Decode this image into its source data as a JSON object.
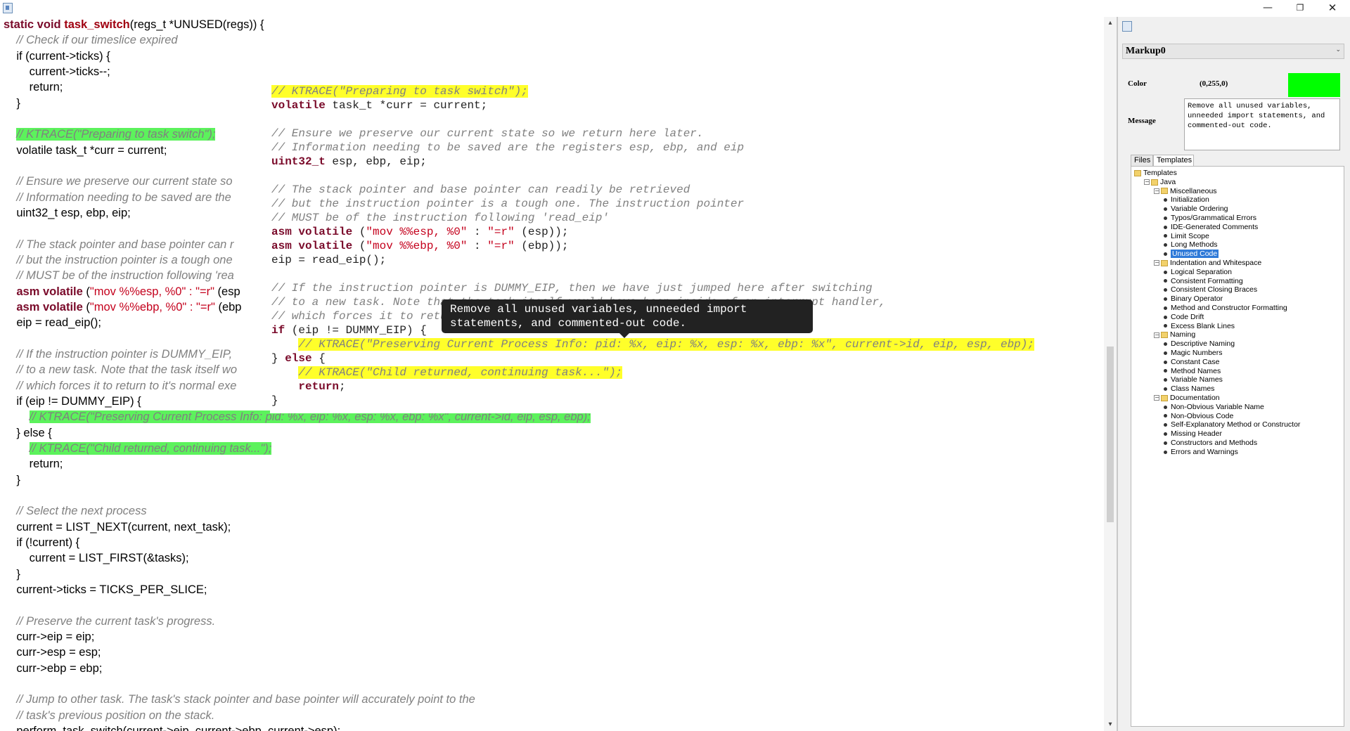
{
  "window": {
    "min_glyph": "—",
    "max_glyph": "❐",
    "close_glyph": "✕"
  },
  "code": {
    "lines": [
      [
        {
          "t": "static void ",
          "c": "kwplain"
        },
        {
          "t": "task_switch",
          "c": "fn"
        },
        {
          "t": "(regs_t *UNUSED(regs)) {",
          "c": "n"
        }
      ],
      [
        {
          "t": "    // Check if our timeslice expired",
          "c": "cm"
        }
      ],
      [
        {
          "t": "    if (current->ticks) {",
          "c": "n"
        }
      ],
      [
        {
          "t": "        current->ticks--;",
          "c": "n"
        }
      ],
      [
        {
          "t": "        return;",
          "c": "n"
        }
      ],
      [
        {
          "t": "    }",
          "c": "n"
        }
      ],
      [],
      [
        {
          "t": "    ",
          "c": "n"
        },
        {
          "t": "// KTRACE(\"Preparing to task switch\");",
          "c": "cm-hl"
        }
      ],
      [
        {
          "t": "    volatile task_t *curr = current;",
          "c": "n"
        }
      ],
      [],
      [
        {
          "t": "    // Ensure we preserve our current state so",
          "c": "cm"
        }
      ],
      [
        {
          "t": "    // Information needing to be saved are the",
          "c": "cm"
        }
      ],
      [
        {
          "t": "    uint32_t esp, ebp, eip;",
          "c": "n"
        }
      ],
      [],
      [
        {
          "t": "    // The stack pointer and base pointer can r",
          "c": "cm"
        }
      ],
      [
        {
          "t": "    // but the instruction pointer is a tough one",
          "c": "cm"
        }
      ],
      [
        {
          "t": "    // MUST be of the instruction following 'rea",
          "c": "cm"
        }
      ],
      [
        {
          "t": "    ",
          "c": "n"
        },
        {
          "t": "asm volatile",
          "c": "kw"
        },
        {
          "t": " (",
          "c": "n"
        },
        {
          "t": "\"mov %%esp, %0\" : \"=r\"",
          "c": "str"
        },
        {
          "t": " (esp",
          "c": "n"
        }
      ],
      [
        {
          "t": "    ",
          "c": "n"
        },
        {
          "t": "asm volatile",
          "c": "kw"
        },
        {
          "t": " (",
          "c": "n"
        },
        {
          "t": "\"mov %%ebp, %0\" : \"=r\"",
          "c": "str"
        },
        {
          "t": " (ebp",
          "c": "n"
        }
      ],
      [
        {
          "t": "    eip = read_eip();",
          "c": "n"
        }
      ],
      [],
      [
        {
          "t": "    // If the instruction pointer is DUMMY_EIP,",
          "c": "cm"
        }
      ],
      [
        {
          "t": "    // to a new task. Note that the task itself wo",
          "c": "cm"
        }
      ],
      [
        {
          "t": "    // which forces it to return to it's normal exe",
          "c": "cm"
        }
      ],
      [
        {
          "t": "    if (eip != DUMMY_EIP) {",
          "c": "n"
        }
      ],
      [
        {
          "t": "        ",
          "c": "n"
        },
        {
          "t": "// KTRACE(\"Preserving Current Process Info: pid: %x, eip: %x, esp: %x, ebp: %x\", current->id, eip, esp, ebp);",
          "c": "cm-hl"
        }
      ],
      [
        {
          "t": "    } else {",
          "c": "n"
        }
      ],
      [
        {
          "t": "        ",
          "c": "n"
        },
        {
          "t": "// KTRACE(\"Child returned, continuing task...\");",
          "c": "cm-hl"
        }
      ],
      [
        {
          "t": "        return;",
          "c": "n"
        }
      ],
      [
        {
          "t": "    }",
          "c": "n"
        }
      ],
      [],
      [
        {
          "t": "    // Select the next process",
          "c": "cm"
        }
      ],
      [
        {
          "t": "    current = LIST_NEXT(current, next_task);",
          "c": "n"
        }
      ],
      [
        {
          "t": "    if (!current) {",
          "c": "n"
        }
      ],
      [
        {
          "t": "        current = LIST_FIRST(&tasks);",
          "c": "n"
        }
      ],
      [
        {
          "t": "    }",
          "c": "n"
        }
      ],
      [
        {
          "t": "    current->ticks = TICKS_PER_SLICE;",
          "c": "n"
        }
      ],
      [],
      [
        {
          "t": "    // Preserve the current task's progress.",
          "c": "cm"
        }
      ],
      [
        {
          "t": "    curr->eip = eip;",
          "c": "n"
        }
      ],
      [
        {
          "t": "    curr->esp = esp;",
          "c": "n"
        }
      ],
      [
        {
          "t": "    curr->ebp = ebp;",
          "c": "n"
        }
      ],
      [],
      [
        {
          "t": "    // Jump to other task. The task's stack pointer and base pointer will accurately point to the",
          "c": "cm"
        }
      ],
      [
        {
          "t": "    // task's previous position on the stack.",
          "c": "cm"
        }
      ],
      [
        {
          "t": "    perform_task_switch(current->eip, current->ebp, current->esp);",
          "c": "n"
        }
      ]
    ]
  },
  "overlay": {
    "lines": [
      [
        {
          "t": "// KTRACE(\"Preparing to task switch\");",
          "c": "cm-hl"
        }
      ],
      [
        {
          "t": "volatile task_t *curr = current;",
          "c": "kwstart"
        }
      ],
      [],
      [
        {
          "t": "// Ensure we preserve our current state so we return here later.",
          "c": "cm"
        }
      ],
      [
        {
          "t": "// Information needing to be saved are the registers esp, ebp, and eip",
          "c": "cm"
        }
      ],
      [
        {
          "t": "uint32_t",
          "c": "kw"
        },
        {
          "t": " esp, ebp, eip;",
          "c": "n"
        }
      ],
      [],
      [
        {
          "t": "// The stack pointer and base pointer can readily be retrieved",
          "c": "cm"
        }
      ],
      [
        {
          "t": "// but the instruction pointer is a tough one. The instruction pointer",
          "c": "cm"
        }
      ],
      [
        {
          "t": "// MUST be of the instruction following 'read_eip'",
          "c": "cm"
        }
      ],
      [
        {
          "t": "asm ",
          "c": "kw"
        },
        {
          "t": "volatile",
          "c": "kw"
        },
        {
          "t": " (",
          "c": "n"
        },
        {
          "t": "\"mov %%esp, %0\"",
          "c": "str"
        },
        {
          "t": " : ",
          "c": "n"
        },
        {
          "t": "\"=r\"",
          "c": "str"
        },
        {
          "t": " (esp));",
          "c": "n"
        }
      ],
      [
        {
          "t": "asm ",
          "c": "kw"
        },
        {
          "t": "volatile",
          "c": "kw"
        },
        {
          "t": " (",
          "c": "n"
        },
        {
          "t": "\"mov %%ebp, %0\"",
          "c": "str"
        },
        {
          "t": " : ",
          "c": "n"
        },
        {
          "t": "\"=r\"",
          "c": "str"
        },
        {
          "t": " (ebp));",
          "c": "n"
        }
      ],
      [
        {
          "t": "eip = read_eip();",
          "c": "n"
        }
      ],
      [],
      [
        {
          "t": "// If the instruction pointer is DUMMY_EIP, then we have just jumped here after switching",
          "c": "cm"
        }
      ],
      [
        {
          "t": "// to a new task. Note that the task itself would have been inside of an interrupt handler,",
          "c": "cm"
        }
      ],
      [
        {
          "t": "// which forces it to return to it's normal execution.",
          "c": "cm"
        }
      ],
      [
        {
          "t": "if",
          "c": "kw"
        },
        {
          "t": " (eip != DUMMY_EIP) {",
          "c": "n"
        }
      ],
      [
        {
          "t": "    ",
          "c": "n"
        },
        {
          "t": "// KTRACE(\"Preserving Current Process Info: pid: %x, eip: %x, esp: %x, ebp: %x\", current->id, eip, esp, ebp);",
          "c": "cm-hl"
        }
      ],
      [
        {
          "t": "} ",
          "c": "n"
        },
        {
          "t": "else",
          "c": "kw"
        },
        {
          "t": " {",
          "c": "n"
        }
      ],
      [
        {
          "t": "    ",
          "c": "n"
        },
        {
          "t": "// KTRACE(\"Child returned, continuing task...\");",
          "c": "cm-hl"
        }
      ],
      [
        {
          "t": "    ",
          "c": "n"
        },
        {
          "t": "return",
          "c": "kw"
        },
        {
          "t": ";",
          "c": "n"
        }
      ],
      [
        {
          "t": "}",
          "c": "n"
        }
      ]
    ]
  },
  "tooltip": {
    "text": "Remove all unused variables, unneeded import\nstatements, and commented-out code."
  },
  "scrollbar": {
    "up_glyph": "▴",
    "down_glyph": "▾",
    "thumb_start": 0.46,
    "thumb_end": 0.715
  },
  "right_panel": {
    "markup_name": "Markup0",
    "chevron": "⌄",
    "color_label": "Color",
    "color_value": "(0,255,0)",
    "color_hex": "#00ff00",
    "message_label": "Message",
    "message_text": "Remove all unused variables, unneeded import statements, and commented-out code.",
    "tabs": [
      "Files",
      "Templates"
    ],
    "active_tab": "Templates"
  },
  "tree": [
    {
      "label": "Templates",
      "level": 0,
      "kind": "folder"
    },
    {
      "label": "Java",
      "level": 1,
      "kind": "folder",
      "expanded": true
    },
    {
      "label": "Miscellaneous",
      "level": 2,
      "kind": "folder",
      "expanded": true
    },
    {
      "label": "Initialization",
      "level": 3,
      "kind": "leaf"
    },
    {
      "label": "Variable Ordering",
      "level": 3,
      "kind": "leaf"
    },
    {
      "label": "Typos/Grammatical Errors",
      "level": 3,
      "kind": "leaf"
    },
    {
      "label": "IDE-Generated Comments",
      "level": 3,
      "kind": "leaf"
    },
    {
      "label": "Limit Scope",
      "level": 3,
      "kind": "leaf"
    },
    {
      "label": "Long Methods",
      "level": 3,
      "kind": "leaf"
    },
    {
      "label": "Unused Code",
      "level": 3,
      "kind": "leaf",
      "selected": true
    },
    {
      "label": "Indentation and Whitespace",
      "level": 2,
      "kind": "folder",
      "expanded": true
    },
    {
      "label": "Logical Separation",
      "level": 3,
      "kind": "leaf"
    },
    {
      "label": "Consistent Formatting",
      "level": 3,
      "kind": "leaf"
    },
    {
      "label": "Consistent Closing Braces",
      "level": 3,
      "kind": "leaf"
    },
    {
      "label": "Binary Operator",
      "level": 3,
      "kind": "leaf"
    },
    {
      "label": "Method and Constructor Formatting",
      "level": 3,
      "kind": "leaf"
    },
    {
      "label": "Code Drift",
      "level": 3,
      "kind": "leaf"
    },
    {
      "label": "Excess Blank Lines",
      "level": 3,
      "kind": "leaf"
    },
    {
      "label": "Naming",
      "level": 2,
      "kind": "folder",
      "expanded": true
    },
    {
      "label": "Descriptive Naming",
      "level": 3,
      "kind": "leaf"
    },
    {
      "label": "Magic Numbers",
      "level": 3,
      "kind": "leaf"
    },
    {
      "label": "Constant Case",
      "level": 3,
      "kind": "leaf"
    },
    {
      "label": "Method Names",
      "level": 3,
      "kind": "leaf"
    },
    {
      "label": "Variable Names",
      "level": 3,
      "kind": "leaf"
    },
    {
      "label": "Class Names",
      "level": 3,
      "kind": "leaf"
    },
    {
      "label": "Documentation",
      "level": 2,
      "kind": "folder",
      "expanded": true
    },
    {
      "label": "Non-Obvious Variable Name",
      "level": 3,
      "kind": "leaf"
    },
    {
      "label": "Non-Obvious Code",
      "level": 3,
      "kind": "leaf"
    },
    {
      "label": "Self-Explanatory Method or Constructor",
      "level": 3,
      "kind": "leaf"
    },
    {
      "label": "Missing Header",
      "level": 3,
      "kind": "leaf"
    },
    {
      "label": "Constructors and Methods",
      "level": 3,
      "kind": "leaf"
    },
    {
      "label": "Errors and Warnings",
      "level": 3,
      "kind": "leaf"
    }
  ]
}
